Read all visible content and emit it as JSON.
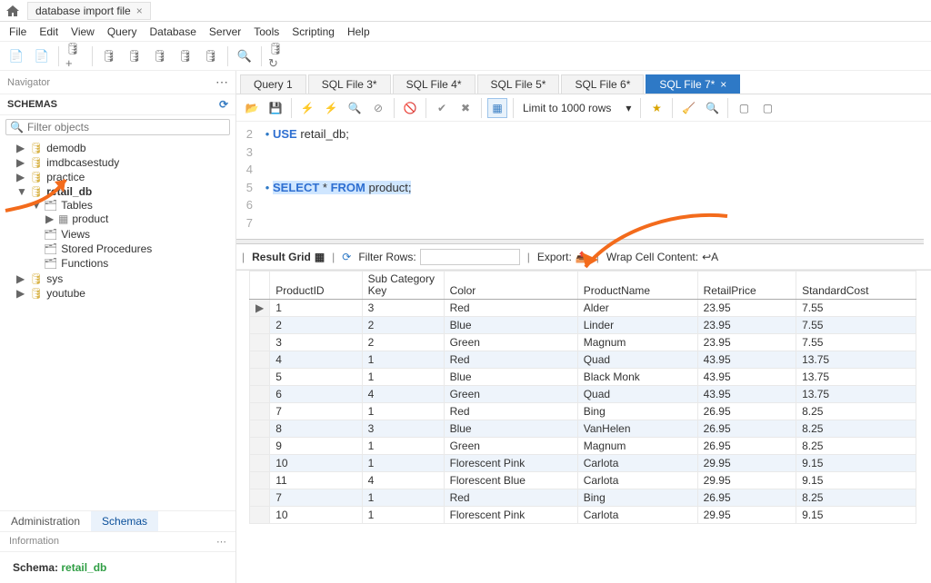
{
  "topbar": {
    "tab_name": "database import file"
  },
  "menu": [
    "File",
    "Edit",
    "View",
    "Query",
    "Database",
    "Server",
    "Tools",
    "Scripting",
    "Help"
  ],
  "navigator_label": "Navigator",
  "schemas_label": "SCHEMAS",
  "filter_placeholder": "Filter objects",
  "tree": {
    "demodb": "demodb",
    "imdbcasestudy": "imdbcasestudy",
    "practice": "practice",
    "retail_db": "retail_db",
    "tables": "Tables",
    "product": "product",
    "views": "Views",
    "sp": "Stored Procedures",
    "fn": "Functions",
    "sys": "sys",
    "youtube": "youtube"
  },
  "tabs": {
    "q1": "Query 1",
    "f3": "SQL File 3*",
    "f4": "SQL File 4*",
    "f5": "SQL File 5*",
    "f6": "SQL File 6*",
    "f7": "SQL File 7*"
  },
  "limit_label": "Limit to 1000 rows",
  "editor": {
    "l2": "2",
    "l3": "3",
    "l4": "4",
    "l5": "5",
    "l6": "6",
    "l7": "7",
    "use": "USE",
    "retail": " retail_db;",
    "select": "SELECT",
    "star": " * ",
    "from": "FROM",
    "prod": " product;"
  },
  "result": {
    "grid_label": "Result Grid",
    "filter_label": "Filter Rows:",
    "export_label": "Export:",
    "wrap_label": "Wrap Cell Content:"
  },
  "cols": {
    "pid": "ProductID",
    "sck": "Sub Category Key",
    "color": "Color",
    "pname": "ProductName",
    "rprice": "RetailPrice",
    "scost": "StandardCost"
  },
  "rows": [
    {
      "pid": "1",
      "sck": "3",
      "color": "Red",
      "pname": "Alder",
      "rprice": "23.95",
      "scost": "7.55"
    },
    {
      "pid": "2",
      "sck": "2",
      "color": "Blue",
      "pname": "Linder",
      "rprice": "23.95",
      "scost": "7.55"
    },
    {
      "pid": "3",
      "sck": "2",
      "color": "Green",
      "pname": "Magnum",
      "rprice": "23.95",
      "scost": "7.55"
    },
    {
      "pid": "4",
      "sck": "1",
      "color": "Red",
      "pname": "Quad",
      "rprice": "43.95",
      "scost": "13.75"
    },
    {
      "pid": "5",
      "sck": "1",
      "color": "Blue",
      "pname": "Black Monk",
      "rprice": "43.95",
      "scost": "13.75"
    },
    {
      "pid": "6",
      "sck": "4",
      "color": "Green",
      "pname": "Quad",
      "rprice": "43.95",
      "scost": "13.75"
    },
    {
      "pid": "7",
      "sck": "1",
      "color": "Red",
      "pname": "Bing",
      "rprice": "26.95",
      "scost": "8.25"
    },
    {
      "pid": "8",
      "sck": "3",
      "color": "Blue",
      "pname": "VanHelen",
      "rprice": "26.95",
      "scost": "8.25"
    },
    {
      "pid": "9",
      "sck": "1",
      "color": "Green",
      "pname": "Magnum",
      "rprice": "26.95",
      "scost": "8.25"
    },
    {
      "pid": "10",
      "sck": "1",
      "color": "Florescent Pink",
      "pname": "Carlota",
      "rprice": "29.95",
      "scost": "9.15"
    },
    {
      "pid": "11",
      "sck": "4",
      "color": "Florescent Blue",
      "pname": "Carlota",
      "rprice": "29.95",
      "scost": "9.15"
    },
    {
      "pid": "7",
      "sck": "1",
      "color": "Red",
      "pname": "Bing",
      "rprice": "26.95",
      "scost": "8.25"
    },
    {
      "pid": "10",
      "sck": "1",
      "color": "Florescent Pink",
      "pname": "Carlota",
      "rprice": "29.95",
      "scost": "9.15"
    }
  ],
  "bot": {
    "admin": "Administration",
    "schemas": "Schemas",
    "info": "Information",
    "schema_lbl": "Schema: ",
    "schema_val": "retail_db"
  }
}
